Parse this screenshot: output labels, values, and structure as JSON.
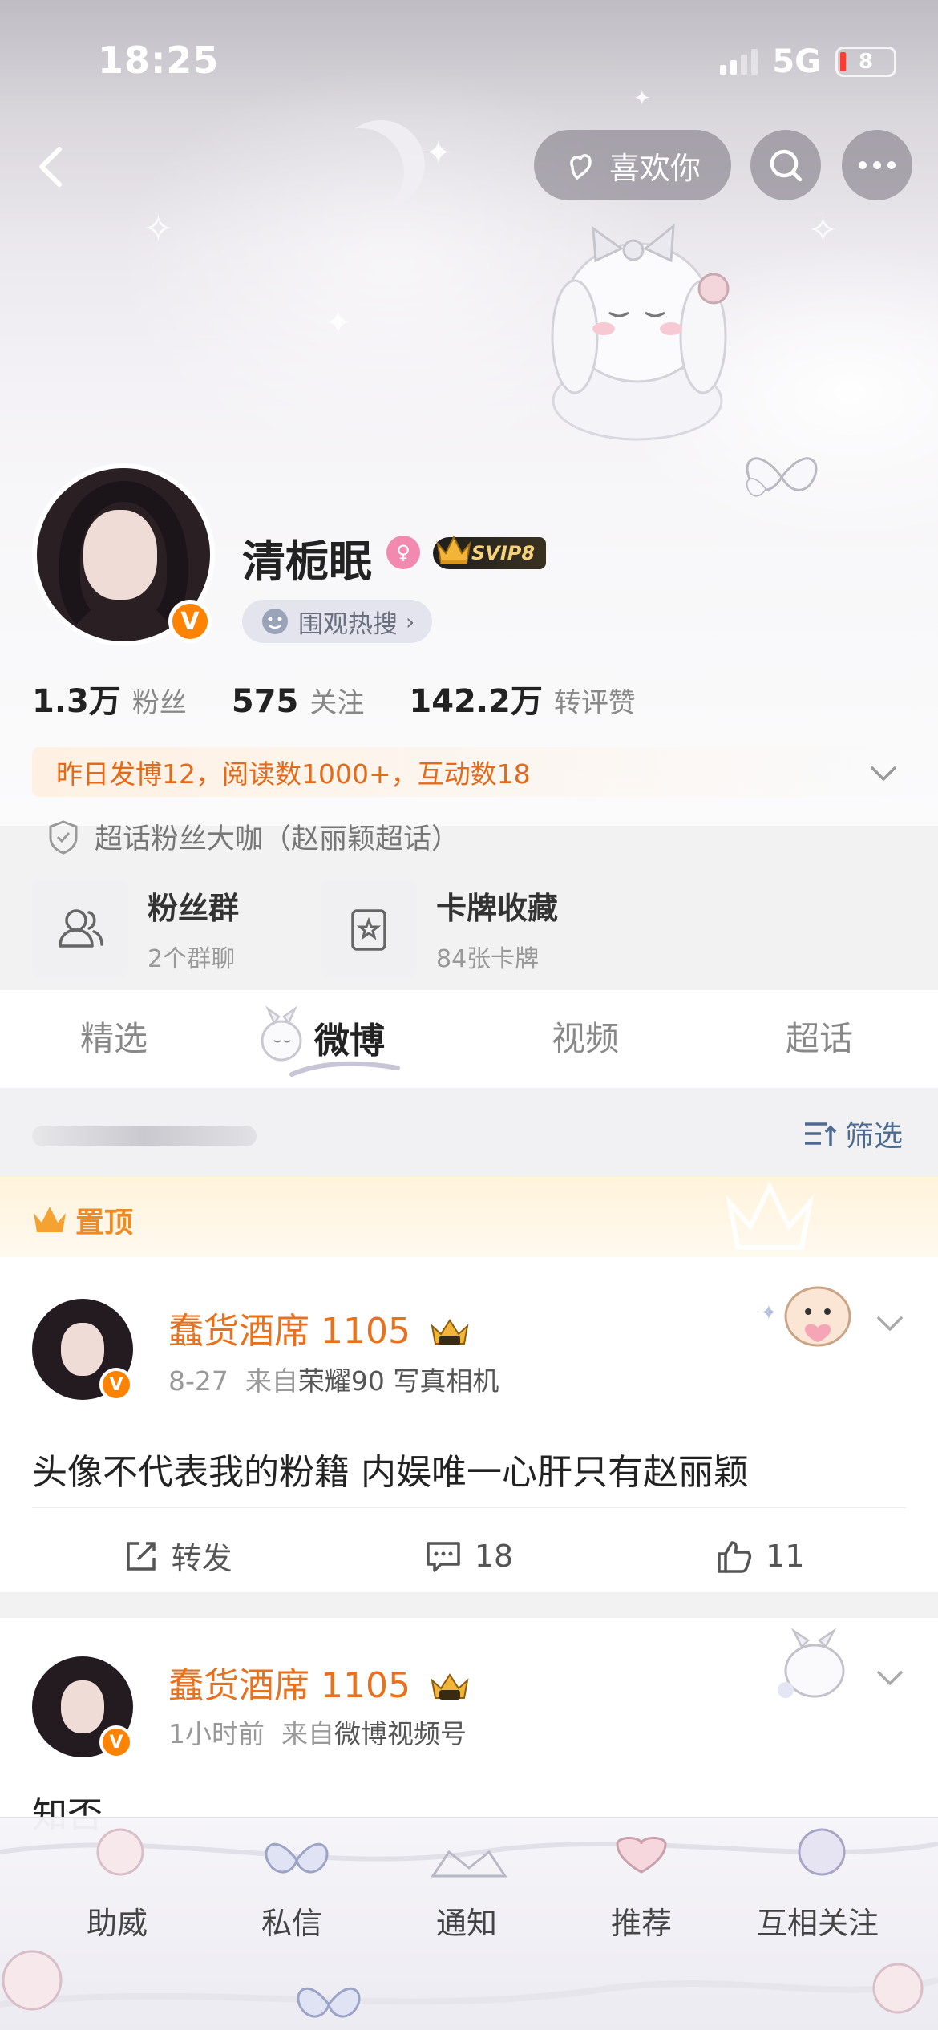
{
  "status": {
    "time": "18:25",
    "network": "5G",
    "battery": "8"
  },
  "nav": {
    "like_label": "喜欢你"
  },
  "profile": {
    "name": "清栀眠",
    "vip_badge": "SVIP8",
    "hot_search_label": "围观热搜",
    "stats": [
      {
        "value": "1.3万",
        "label": "粉丝"
      },
      {
        "value": "575",
        "label": "关注"
      },
      {
        "value": "142.2万",
        "label": "转评赞"
      }
    ],
    "activity": "昨日发博12，阅读数1000+，互动数18",
    "fan_title": "超话粉丝大咖（赵丽颖超话）",
    "cards": [
      {
        "title": "粉丝群",
        "sub": "2个群聊",
        "icon": "group-icon"
      },
      {
        "title": "卡牌收藏",
        "sub": "84张卡牌",
        "icon": "card-icon"
      }
    ]
  },
  "tabs": [
    "精选",
    "微博",
    "视频",
    "超话"
  ],
  "active_tab": "微博",
  "filter": {
    "label": "筛选"
  },
  "pinned_label": "置顶",
  "posts": [
    {
      "author": "蠢货酒席 1105",
      "date": "8-27",
      "source_prefix": "来自",
      "source": "荣耀90 写真相机",
      "text": "头像不代表我的粉籍 内娱唯一心肝只有赵丽颖",
      "repost_label": "转发",
      "comments": "18",
      "likes": "11"
    },
    {
      "author": "蠢货酒席 1105",
      "date": "1小时前",
      "source_prefix": "来自",
      "source": "微博视频号",
      "text": "知否"
    }
  ],
  "bottom_bar": [
    "助威",
    "私信",
    "通知",
    "推荐",
    "互相关注"
  ],
  "colors": {
    "accent_orange": "#e8711e",
    "vip_gold": "#f5d27b",
    "link_blue": "#4d6b8f"
  }
}
